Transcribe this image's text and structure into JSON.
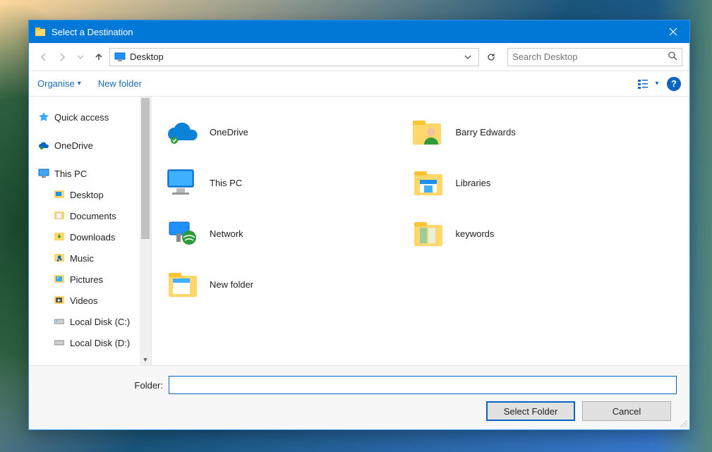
{
  "window": {
    "title": "Select a Destination"
  },
  "address": {
    "crumb": "Desktop"
  },
  "search": {
    "placeholder": "Search Desktop"
  },
  "toolbar": {
    "organise": "Organise",
    "newfolder": "New folder"
  },
  "sidebar": {
    "quick_access": "Quick access",
    "onedrive": "OneDrive",
    "this_pc": "This PC",
    "desktop": "Desktop",
    "documents": "Documents",
    "downloads": "Downloads",
    "music": "Music",
    "pictures": "Pictures",
    "videos": "Videos",
    "local_c": "Local Disk (C:)",
    "local_d": "Local Disk (D:)"
  },
  "items": {
    "onedrive": "OneDrive",
    "barry": "Barry Edwards",
    "thispc": "This PC",
    "libraries": "Libraries",
    "network": "Network",
    "keywords": "keywords",
    "newfolder": "New folder"
  },
  "footer": {
    "label": "Folder:",
    "select": "Select Folder",
    "cancel": "Cancel",
    "value": ""
  }
}
